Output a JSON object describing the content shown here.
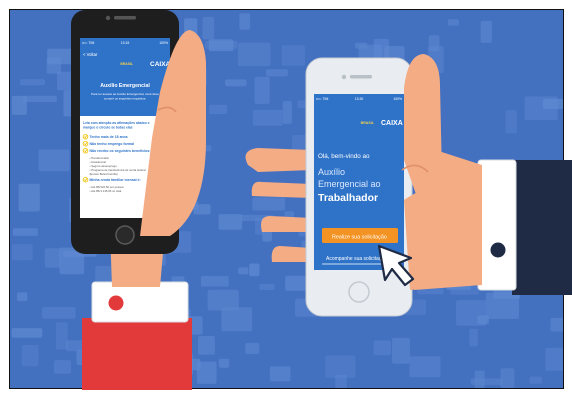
{
  "colors": {
    "background": "#4470c0",
    "background_blocks": "#5f8ad2",
    "skin": "#f4ac84",
    "skin_shadow": "#e0906a",
    "sleeve_red": "#e23a3a",
    "sleeve_navy": "#1f2b44",
    "cuff": "#ffffff",
    "phone_black": "#1e1e1e",
    "phone_silver": "#e9edf1",
    "screen_blue": "#2f73c8",
    "button_orange": "#f39323",
    "check_yellow": "#f1c40f"
  },
  "left_phone": {
    "status_left": "•••○ TIM",
    "status_time": "13:15",
    "status_right": "100%",
    "back_label": "< Voltar",
    "brand_left": "BRASIL",
    "brand_right": "CAIXA",
    "title": "Auxílio Emergencial",
    "intro_line1": "Para ter acesso ao Auxílio Emergencial, você deve",
    "intro_line2": "cumprir os seguintes requisitos:",
    "section_line1": "Leia com atenção as afirmações abaixo e",
    "section_line2": "marque o círculo se todas elas",
    "checklist": [
      "Tenho mais de 18 anos",
      "Não tenho emprego formal",
      "Não recebo os seguintes benefícios:",
      "Minha renda familiar mensal é:"
    ],
    "benefit_lines": [
      "• Previdenciário",
      "• Assistencial",
      "• Seguro-desemprego",
      "• Programa de transferência de renda federal",
      "  (Exceto Bolsa Família)"
    ],
    "income_lines": [
      "• Até R$ 522,50 por pessoa",
      "• Até R$ 3.135,00 no total"
    ]
  },
  "right_phone": {
    "status_left": "•••○ TIM",
    "status_time": "13:30",
    "status_right": "100%",
    "brand_left": "BRASIL",
    "brand_right": "CAIXA",
    "greeting": "Olá, bem-vindo ao",
    "title_line1": "Auxílio",
    "title_line2": "Emergencial ao",
    "title_line3": "Trabalhador",
    "primary_button": "Realize sua solicitação",
    "secondary_button": "Acompanhe sua solicitação"
  }
}
